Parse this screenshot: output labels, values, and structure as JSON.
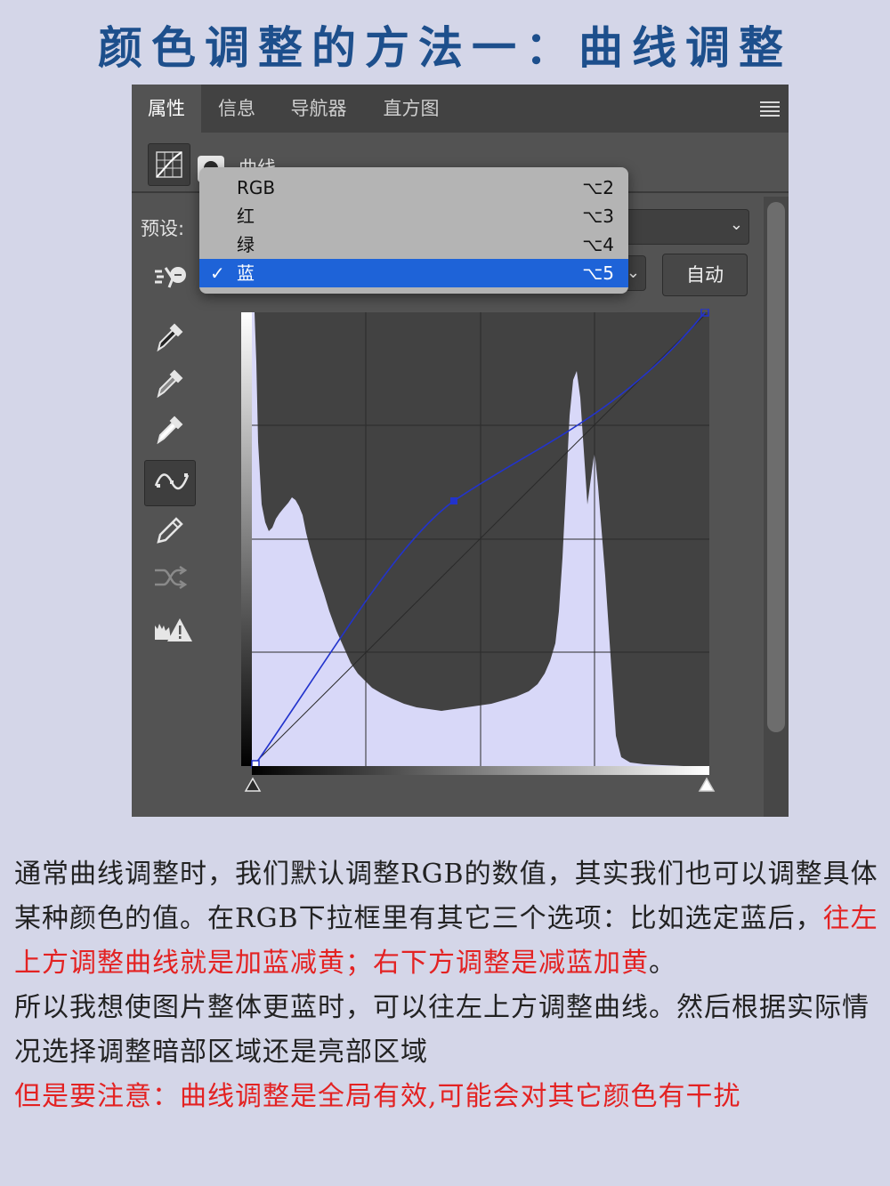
{
  "title": "颜色调整的方法一：曲线调整",
  "tabs": [
    {
      "label": "属性",
      "active": true
    },
    {
      "label": "信息",
      "active": false
    },
    {
      "label": "导航器",
      "active": false
    },
    {
      "label": "直方图",
      "active": false
    }
  ],
  "panel": {
    "adjustment_label": "曲线",
    "preset_label": "预设:",
    "auto_button": "自动",
    "menu_icon": "hamburger-menu-icon"
  },
  "dropdown": {
    "items": [
      {
        "label": "RGB",
        "shortcut": "⌥2",
        "selected": false
      },
      {
        "label": "红",
        "shortcut": "⌥3",
        "selected": false
      },
      {
        "label": "绿",
        "shortcut": "⌥4",
        "selected": false
      },
      {
        "label": "蓝",
        "shortcut": "⌥5",
        "selected": true
      }
    ],
    "check_mark": "✓"
  },
  "tools": [
    {
      "name": "on-image-adjust-icon"
    },
    {
      "name": "black-point-eyedropper-icon"
    },
    {
      "name": "gray-point-eyedropper-icon"
    },
    {
      "name": "white-point-eyedropper-icon"
    },
    {
      "name": "curve-point-tool-icon",
      "active": true
    },
    {
      "name": "pencil-icon"
    },
    {
      "name": "smooth-curve-icon"
    },
    {
      "name": "clipping-warning-icon"
    }
  ],
  "colors": {
    "panel_bg": "#535353",
    "histogram_fill": "#d8d8f8",
    "curve_color": "#2233cc",
    "selected_item": "#1e63d8",
    "title_color": "#1d4f8c",
    "highlight_red": "#e32222"
  },
  "description": {
    "p1": "通常曲线调整时，我们默认调整RGB的数值，其实我们也可以调整具体某种颜色的值。在RGB下拉框里有其它三个选项：比如选定蓝后，",
    "p1_red": "往左上方调整曲线就是加蓝减黄；右下方调整是减蓝加黄",
    "p1_end": "。",
    "p2": "所以我想使图片整体更蓝时，可以往左上方调整曲线。然后根据实际情况选择调整暗部区域还是亮部区域",
    "p3_red": "但是要注意：曲线调整是全局有效,可能会对其它颜色有干扰"
  }
}
